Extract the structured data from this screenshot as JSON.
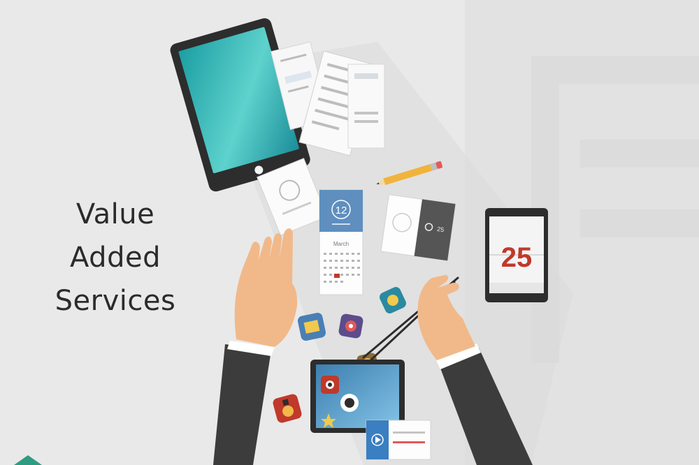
{
  "headline": {
    "line1": "Value  Added",
    "line2": "Services"
  },
  "calendar_small": {
    "day": "12",
    "month": "March"
  },
  "calendar_flip": {
    "day": "25"
  },
  "card": {
    "temp": "25"
  },
  "colors": {
    "background": "#e9e9e9",
    "tablet_screen": "#2bb3b3",
    "device_frame": "#2d2d2d",
    "calendar_header": "#5e8fbf",
    "calendar_accent": "#c0392b",
    "pencil": "#f0b43c",
    "skin": "#f1b98a",
    "suit": "#3c3c3c"
  }
}
